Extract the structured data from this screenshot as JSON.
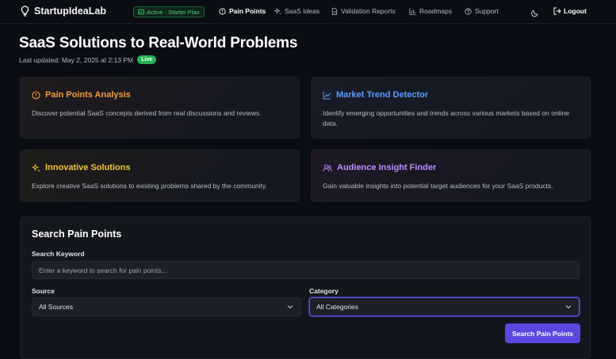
{
  "nav": {
    "brand": "StartupIdeaLab",
    "plan_badge": "Active - Starter Plan",
    "items": [
      {
        "label": "Pain Points",
        "icon": "alert-circle-icon",
        "active": true
      },
      {
        "label": "SaaS Ideas",
        "icon": "sparkles-icon",
        "active": false
      },
      {
        "label": "Validation Reports",
        "icon": "file-icon",
        "active": false
      },
      {
        "label": "Roadmaps",
        "icon": "bar-chart-icon",
        "active": false
      },
      {
        "label": "Support",
        "icon": "help-circle-icon",
        "active": false
      }
    ],
    "theme_icon": "moon-icon",
    "logout": "Logout"
  },
  "header": {
    "title": "SaaS Solutions to Real-World Problems",
    "updated": "Last updated: May 2, 2025 at 2:13 PM",
    "live": "Live"
  },
  "cards": [
    {
      "title": "Pain Points Analysis",
      "icon": "alert-circle-icon",
      "color": "#f39a3f",
      "desc": "Discover potential SaaS concepts derived from real discussions and reviews."
    },
    {
      "title": "Market Trend Detector",
      "icon": "trend-line-icon",
      "color": "#5b9dff",
      "desc": "Identify emerging opportunities and trends across various markets based on online data."
    },
    {
      "title": "Innovative Solutions",
      "icon": "sparkles-icon",
      "color": "#f2c23a",
      "desc": "Explore creative SaaS solutions to existing problems shared by the community."
    },
    {
      "title": "Audience Insight Finder",
      "icon": "users-icon",
      "color": "#c08aff",
      "desc": "Gain valuable insights into potential target audiences for your SaaS products."
    }
  ],
  "search": {
    "title": "Search Pain Points",
    "keyword_label": "Search Keyword",
    "keyword_placeholder": "Enter a keyword to search for pain points...",
    "source_label": "Source",
    "source_value": "All Sources",
    "category_label": "Category",
    "category_value": "All Categories",
    "button": "Search Pain Points"
  },
  "colors": {
    "accent": "#5a47e0",
    "success": "#22b455",
    "background": "#0b0d14"
  }
}
